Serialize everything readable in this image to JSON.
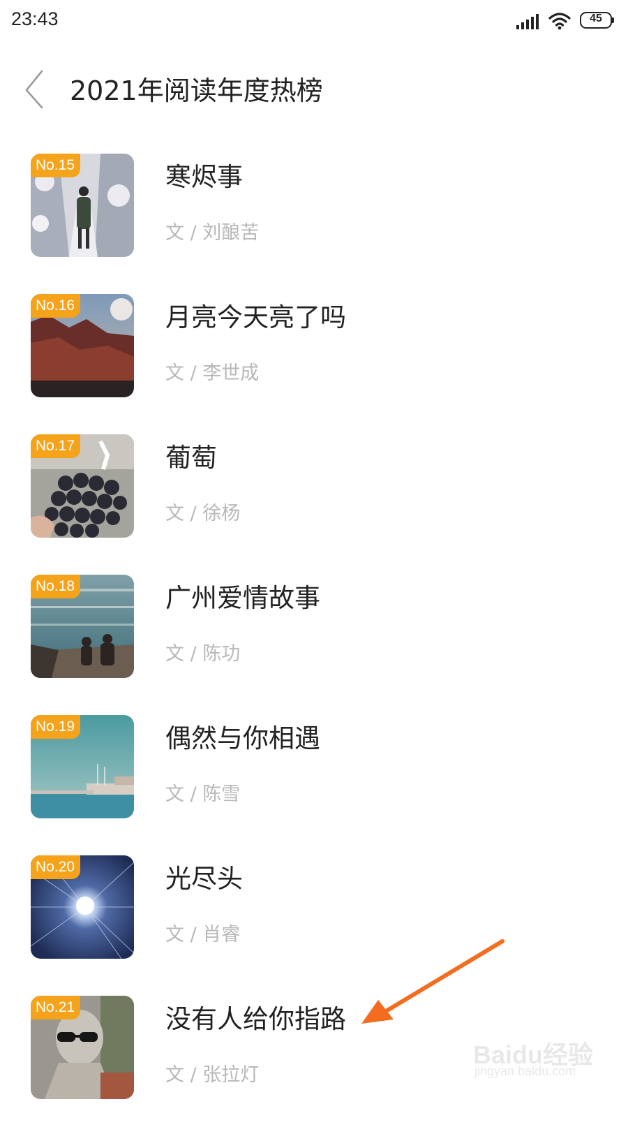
{
  "status_bar": {
    "time": "23:43",
    "signal_icon": "signal-icon",
    "wifi_icon": "wifi-icon",
    "battery_level": "45"
  },
  "header": {
    "back_icon": "chevron-left-icon",
    "title": "2021年阅读年度热榜"
  },
  "books": [
    {
      "rank": "No.15",
      "title": "寒烬事",
      "author": "文 / 刘酿苦",
      "cover": "snowy-path-cover"
    },
    {
      "rank": "No.16",
      "title": "月亮今天亮了吗",
      "author": "文 / 李世成",
      "cover": "moon-mountain-cover"
    },
    {
      "rank": "No.17",
      "title": "葡萄",
      "author": "文 / 徐杨",
      "cover": "grapes-cover"
    },
    {
      "rank": "No.18",
      "title": "广州爱情故事",
      "author": "文 / 陈功",
      "cover": "seaside-couple-cover"
    },
    {
      "rank": "No.19",
      "title": "偶然与你相遇",
      "author": "文 / 陈雪",
      "cover": "harbor-cover"
    },
    {
      "rank": "No.20",
      "title": "光尽头",
      "author": "文 / 肖睿",
      "cover": "light-burst-cover"
    },
    {
      "rank": "No.21",
      "title": "没有人给你指路",
      "author": "文 / 张拉灯",
      "cover": "statue-cover"
    }
  ],
  "annotation": {
    "arrow_color": "#f36d21"
  },
  "watermark": {
    "logo": "Baidu经验",
    "url": "jingyan.baidu.com"
  },
  "colors": {
    "badge": "#f5a31a",
    "author_text": "#b8b8b8"
  }
}
